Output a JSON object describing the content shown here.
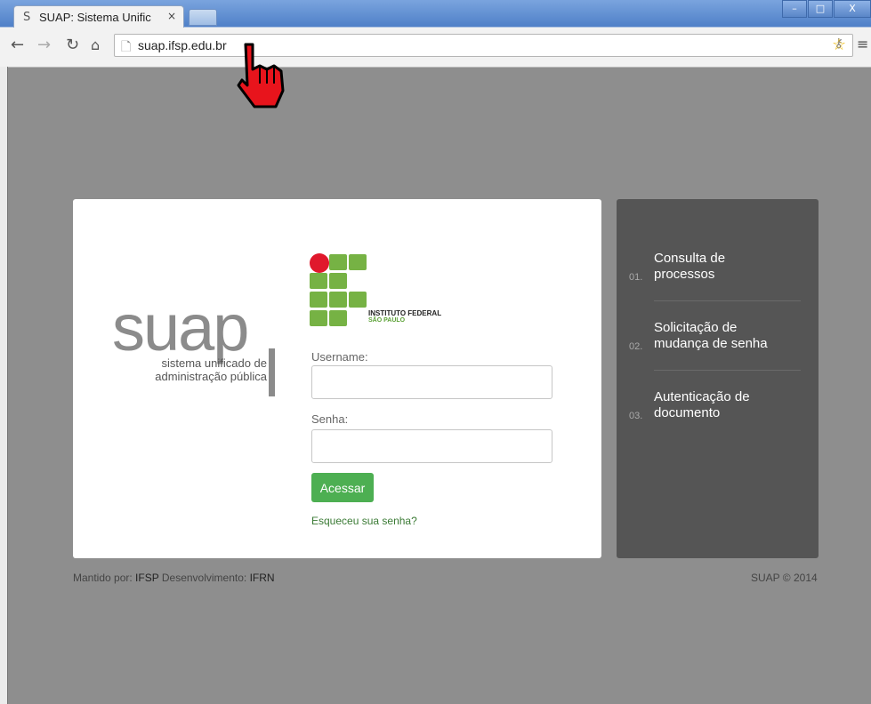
{
  "browser": {
    "tab_title": "SUAP: Sistema Unific",
    "tab_favicon": "S",
    "tab_close": "×",
    "url": "suap.ifsp.edu.br",
    "window_buttons": {
      "minimize": "–",
      "restore": "□",
      "close": "X"
    },
    "icons": {
      "back": "back-arrow-icon",
      "forward": "forward-arrow-icon",
      "reload": "reload-icon",
      "home": "home-icon",
      "page": "page-icon",
      "key": "key-icon",
      "star": "star-icon",
      "menu": "menu-icon"
    }
  },
  "login": {
    "logo_word": "suap",
    "logo_sub1": "sistema unificado de",
    "logo_sub2": "administração pública",
    "institute_line1": "INSTITUTO FEDERAL",
    "institute_line2": "SÃO PAULO",
    "username_label": "Username:",
    "username_value": "",
    "password_label": "Senha:",
    "password_value": "",
    "submit_label": "Acessar",
    "forgot_label": "Esqueceu sua senha?"
  },
  "sidebar": {
    "items": [
      {
        "num": "01.",
        "line1": "Consulta de",
        "line2": "processos"
      },
      {
        "num": "02.",
        "line1": "Solicitação de",
        "line2": "mudança de senha"
      },
      {
        "num": "03.",
        "line1": "Autenticação de",
        "line2": "documento"
      }
    ]
  },
  "footer": {
    "maintained_label": "Mantido por:",
    "maintained_value": "IFSP",
    "dev_label": "Desenvolvimento:",
    "dev_value": "IFRN",
    "copyright": "SUAP © 2014"
  },
  "colors": {
    "accent_green": "#4daf52",
    "sidebar_bg": "#555555",
    "page_bg": "#8e8e8e",
    "if_green": "#76b244",
    "if_red": "#e0182c"
  }
}
